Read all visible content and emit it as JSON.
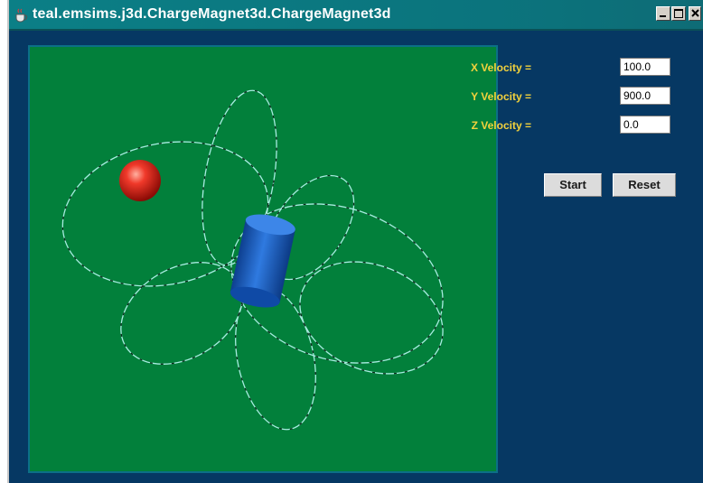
{
  "window": {
    "title": "teal.emsims.j3d.ChargeMagnet3d.ChargeMagnet3d",
    "app_icon": "java-coffee-cup-icon",
    "controls": [
      "minimize-icon",
      "maximize-icon",
      "close-icon"
    ]
  },
  "colors": {
    "window_background": "#063863",
    "titlebar": "#0b7f86",
    "scene_background": "#02803b",
    "label_text": "#f3d23c",
    "charge": "#e8201a",
    "magnet": "#1a5fc0",
    "field_lines": "#9fe3d6"
  },
  "scene": {
    "objects": [
      "red-charge-sphere",
      "blue-bar-magnet",
      "magnetic-field-lines"
    ]
  },
  "controls": {
    "x_velocity": {
      "label": "X Velocity =",
      "value": "100.0"
    },
    "y_velocity": {
      "label": "Y Velocity =",
      "value": "900.0"
    },
    "z_velocity": {
      "label": "Z Velocity =",
      "value": "0.0"
    },
    "start_label": "Start",
    "reset_label": "Reset"
  }
}
